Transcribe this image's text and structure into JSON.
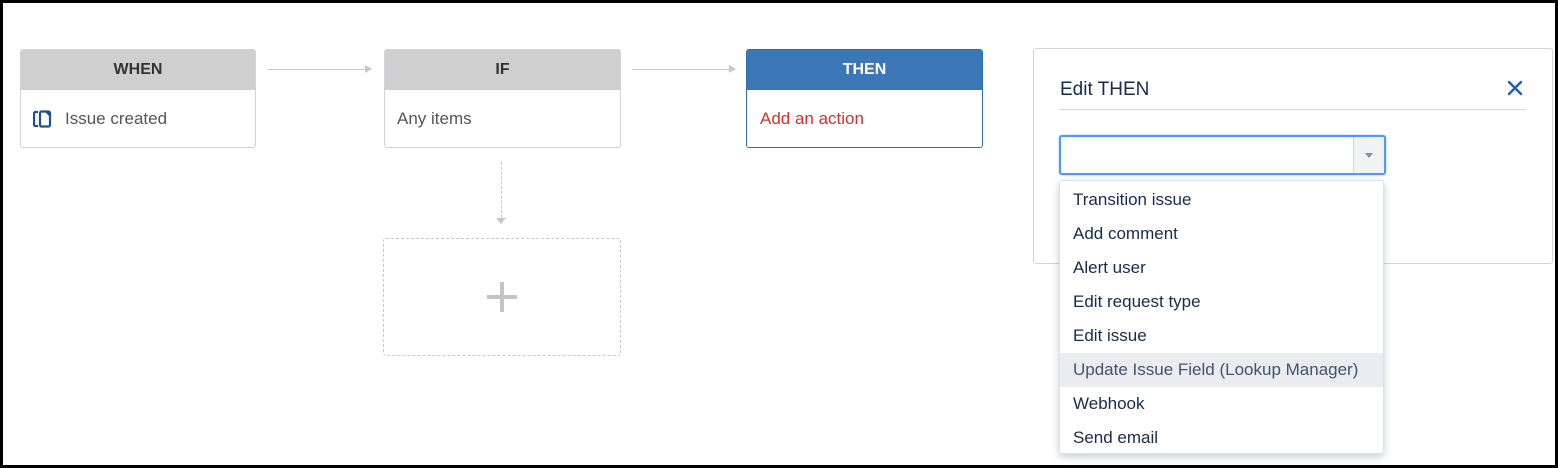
{
  "flow": {
    "when": {
      "header": "WHEN",
      "body": "Issue created",
      "icon": "copy-icon"
    },
    "if": {
      "header": "IF",
      "body": "Any items"
    },
    "then": {
      "header": "THEN",
      "body": "Add an action"
    },
    "add_icon": "plus-icon"
  },
  "panel": {
    "title": "Edit THEN",
    "close_icon": "close-icon",
    "select": {
      "value": "",
      "placeholder": ""
    },
    "options": [
      "Transition issue",
      "Add comment",
      "Alert user",
      "Edit request type",
      "Edit issue",
      "Update Issue Field (Lookup Manager)",
      "Webhook",
      "Send email"
    ],
    "highlighted_option": "Update Issue Field (Lookup Manager)"
  },
  "colors": {
    "then_header": "#3b76b6",
    "then_link": "#d3312b",
    "focus_ring": "#4c9aff",
    "close_icon": "#1f5fb8"
  }
}
